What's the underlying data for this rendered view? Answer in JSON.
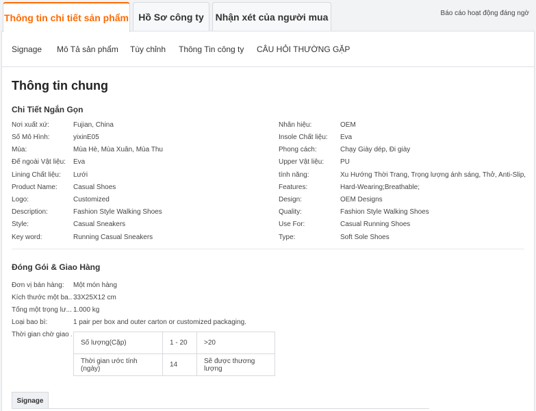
{
  "tabs": [
    {
      "label": "Thông tin chi tiết sản phẩm"
    },
    {
      "label": "Hồ Sơ công ty"
    },
    {
      "label": "Nhận xét của người mua"
    }
  ],
  "report_link": "Báo cáo hoạt động đáng ngờ",
  "subnav": [
    "Signage",
    "Mô Tả sản phẩm",
    "Tùy chỉnh",
    "Thông Tin công ty",
    "CÂU HỎI THƯỜNG GẶP"
  ],
  "main": {
    "title": "Thông tin chung",
    "brief_heading": "Chi Tiết Ngắn Gọn",
    "brief_left": [
      {
        "label": "Nơi xuất xứ:",
        "value": "Fujian, China"
      },
      {
        "label": "Số Mô Hình:",
        "value": "yixinE05"
      },
      {
        "label": "Mùa:",
        "value": "Mùa Hè, Mùa Xuân, Mùa Thu"
      },
      {
        "label": "Đế ngoài Vật liệu:",
        "value": "Eva"
      },
      {
        "label": "Lining Chất liệu:",
        "value": "Lưới"
      },
      {
        "label": "Product Name:",
        "value": "Casual Shoes"
      },
      {
        "label": "Logo:",
        "value": "Customized"
      },
      {
        "label": "Description:",
        "value": "Fashion Style Walking Shoes"
      },
      {
        "label": "Style:",
        "value": "Casual Sneakers"
      },
      {
        "label": "Key word:",
        "value": "Running Casual Sneakers"
      }
    ],
    "brief_right": [
      {
        "label": "Nhãn hiệu:",
        "value": "OEM"
      },
      {
        "label": "Insole Chất liệu:",
        "value": "Eva"
      },
      {
        "label": "Phong cách:",
        "value": "Chạy Giày dép, Đi giày"
      },
      {
        "label": "Upper Vật liệu:",
        "value": "PU"
      },
      {
        "label": "tính năng:",
        "value": "Xu Hướng Thời Trang, Trọng lượng ánh sáng, Thở, Anti-Slip, S..."
      },
      {
        "label": "Features:",
        "value": "Hard-Wearing;Breathable;"
      },
      {
        "label": "Design:",
        "value": "OEM Designs"
      },
      {
        "label": "Quality:",
        "value": "Fashion Style Walking Shoes"
      },
      {
        "label": "Use For:",
        "value": "Casual Running Shoes"
      },
      {
        "label": "Type:",
        "value": "Soft Sole Shoes"
      }
    ],
    "packaging_heading": "Đóng Gói & Giao Hàng",
    "packaging": [
      {
        "label": "Đơn vị bán hàng:",
        "value": "Một món hàng"
      },
      {
        "label": "Kích thước một ba...",
        "value": "33X25X12 cm"
      },
      {
        "label": "Tổng một trọng lư...",
        "value": "1.000 kg"
      },
      {
        "label": "Loại bao bì:",
        "value": "1 pair per box and outer carton or customized packaging."
      }
    ],
    "lead_time_label": "Thời gian chờ giao ...",
    "lead_table": {
      "row1": [
        "Số lượng(Cặp)",
        "1 - 20",
        ">20"
      ],
      "row2": [
        "Thời gian ước tính (ngày)",
        "14",
        "Sẽ được thương lượng"
      ]
    },
    "signage_tab": "Signage"
  }
}
